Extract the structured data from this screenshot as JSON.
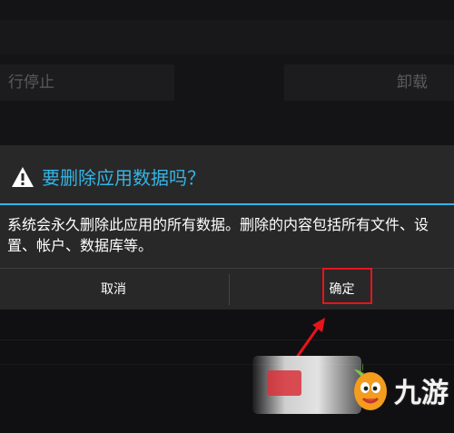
{
  "background": {
    "left_button_label": "行停止",
    "right_button_label": "卸载"
  },
  "dialog": {
    "title": "要删除应用数据吗？",
    "message": "系统会永久删除此应用的所有数据。删除的内容包括所有文件、设置、帐户、数据库等。",
    "cancel_label": "取消",
    "ok_label": "确定"
  },
  "watermark": {
    "text": "九游"
  },
  "colors": {
    "accent": "#33b5e5",
    "highlight": "#e8141c",
    "dialog_bg": "#282829"
  }
}
